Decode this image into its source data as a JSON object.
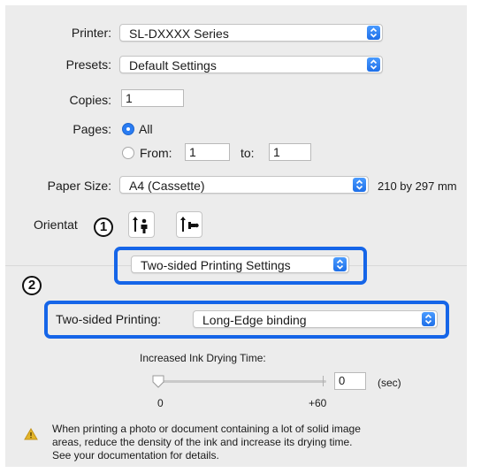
{
  "printer": {
    "label": "Printer:",
    "value": "SL-DXXXX Series"
  },
  "presets": {
    "label": "Presets:",
    "value": "Default Settings"
  },
  "copies": {
    "label": "Copies:",
    "value": "1"
  },
  "pages": {
    "label": "Pages:",
    "all_label": "All",
    "from_label": "From:",
    "from_value": "1",
    "to_label": "to:",
    "to_value": "1",
    "selected": "All"
  },
  "paper_size": {
    "label": "Paper Size:",
    "value": "A4 (Cassette)",
    "dimensions": "210 by 297 mm"
  },
  "orientation": {
    "label": "Orientat",
    "options": [
      "portrait-icon",
      "landscape-icon"
    ],
    "selected": "portrait"
  },
  "section_menu": {
    "value": "Two-sided Printing Settings"
  },
  "two_sided": {
    "label": "Two-sided Printing:",
    "value": "Long-Edge binding"
  },
  "drying": {
    "label": "Increased Ink Drying Time:",
    "value": "0",
    "unit": "(sec)",
    "min_label": "0",
    "max_label": "+60",
    "slider_fraction": 0.0
  },
  "warning": {
    "icon": "warning-icon",
    "text_line1": "When printing a photo or document containing a lot of solid image",
    "text_line2": "areas, reduce the density of the ink and increase its drying time.",
    "text_line3": "See your documentation for details."
  },
  "callouts": {
    "one": "1",
    "two": "2"
  },
  "colors": {
    "accent": "#1565e8",
    "panel": "#ececec",
    "selected_radio": "#2a7cf2"
  }
}
